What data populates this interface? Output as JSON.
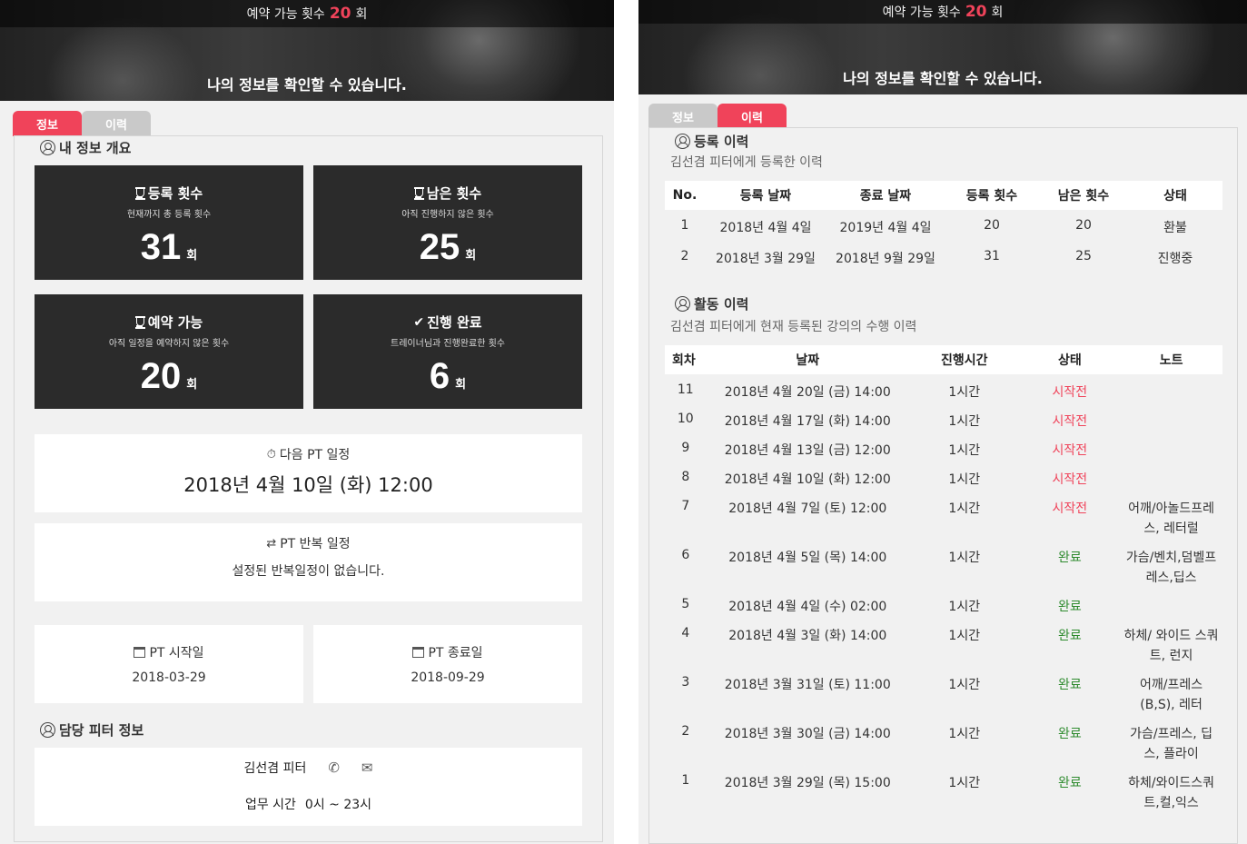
{
  "hero": {
    "available_prefix": "예약 가능 횟수",
    "available_count": "20",
    "available_suffix": "회",
    "subtitle": "나의 정보를 확인할 수 있습니다."
  },
  "tabs": {
    "info": "정보",
    "history": "이력"
  },
  "overview": {
    "title": "내 정보 개요",
    "stats": [
      {
        "title": "등록 횟수",
        "desc": "현재까지 총 등록 횟수",
        "value": "31",
        "unit": "회",
        "icon": "hourglass-icon"
      },
      {
        "title": "남은 횟수",
        "desc": "아직 진행하지 않은 횟수",
        "value": "25",
        "unit": "회",
        "icon": "hourglass-icon"
      },
      {
        "title": "예약 가능",
        "desc": "아직 일정을 예약하지 않은 횟수",
        "value": "20",
        "unit": "회",
        "icon": "hourglass-icon"
      },
      {
        "title": "진행 완료",
        "desc": "트레이너님과 진행완료한 횟수",
        "value": "6",
        "unit": "회",
        "icon": "check-icon"
      }
    ],
    "next_label": "다음 PT 일정",
    "next_value": "2018년 4월 10일 (화) 12:00",
    "repeat_label": "PT 반복 일정",
    "repeat_value": "설정된 반복일정이 없습니다.",
    "start_label": "PT 시작일",
    "start_value": "2018-03-29",
    "end_label": "PT 종료일",
    "end_value": "2018-09-29"
  },
  "trainer": {
    "title": "담당 피터 정보",
    "name": "김선겸 피터",
    "hours_label": "업무 시간",
    "hours_value": "0시 ~ 23시"
  },
  "registration": {
    "title": "등록 이력",
    "desc": "김선겸 피터에게 등록한 이력",
    "headers": [
      "No.",
      "등록 날짜",
      "종료 날짜",
      "등록 횟수",
      "남은 횟수",
      "상태"
    ],
    "rows": [
      [
        "1",
        "2018년 4월 4일",
        "2019년 4월 4일",
        "20",
        "20",
        "환불"
      ],
      [
        "2",
        "2018년 3월 29일",
        "2018년 9월 29일",
        "31",
        "25",
        "진행중"
      ]
    ]
  },
  "activity": {
    "title": "활동 이력",
    "desc": "김선겸 피터에게 현재 등록된 강의의 수행 이력",
    "headers": [
      "회차",
      "날짜",
      "진행시간",
      "상태",
      "노트"
    ],
    "rows": [
      {
        "no": "11",
        "date": "2018년 4월 20일 (금) 14:00",
        "duration": "1시간",
        "status": "시작전",
        "note": ""
      },
      {
        "no": "10",
        "date": "2018년 4월 17일 (화) 14:00",
        "duration": "1시간",
        "status": "시작전",
        "note": ""
      },
      {
        "no": "9",
        "date": "2018년 4월 13일 (금) 12:00",
        "duration": "1시간",
        "status": "시작전",
        "note": ""
      },
      {
        "no": "8",
        "date": "2018년 4월 10일 (화) 12:00",
        "duration": "1시간",
        "status": "시작전",
        "note": ""
      },
      {
        "no": "7",
        "date": "2018년 4월 7일 (토) 12:00",
        "duration": "1시간",
        "status": "시작전",
        "note": "어깨/아놀드프레스, 레터럴"
      },
      {
        "no": "6",
        "date": "2018년 4월 5일 (목) 14:00",
        "duration": "1시간",
        "status": "완료",
        "note": "가슴/벤치,덤벨프레스,딥스"
      },
      {
        "no": "5",
        "date": "2018년 4월 4일 (수) 02:00",
        "duration": "1시간",
        "status": "완료",
        "note": ""
      },
      {
        "no": "4",
        "date": "2018년 4월 3일 (화) 14:00",
        "duration": "1시간",
        "status": "완료",
        "note": "하체/ 와이드 스쿼트, 런지"
      },
      {
        "no": "3",
        "date": "2018년 3월 31일 (토) 11:00",
        "duration": "1시간",
        "status": "완료",
        "note": "어깨/프레스(B,S), 레터"
      },
      {
        "no": "2",
        "date": "2018년 3월 30일 (금) 14:00",
        "duration": "1시간",
        "status": "완료",
        "note": "가슴/프레스, 딥스, 플라이"
      },
      {
        "no": "1",
        "date": "2018년 3월 29일 (목) 15:00",
        "duration": "1시간",
        "status": "완료",
        "note": "하체/와이드스쿼트,컬,익스"
      }
    ]
  },
  "colors": {
    "accent": "#f0435a",
    "done": "#2e8b2e",
    "dark_card": "#2b2b2b"
  }
}
